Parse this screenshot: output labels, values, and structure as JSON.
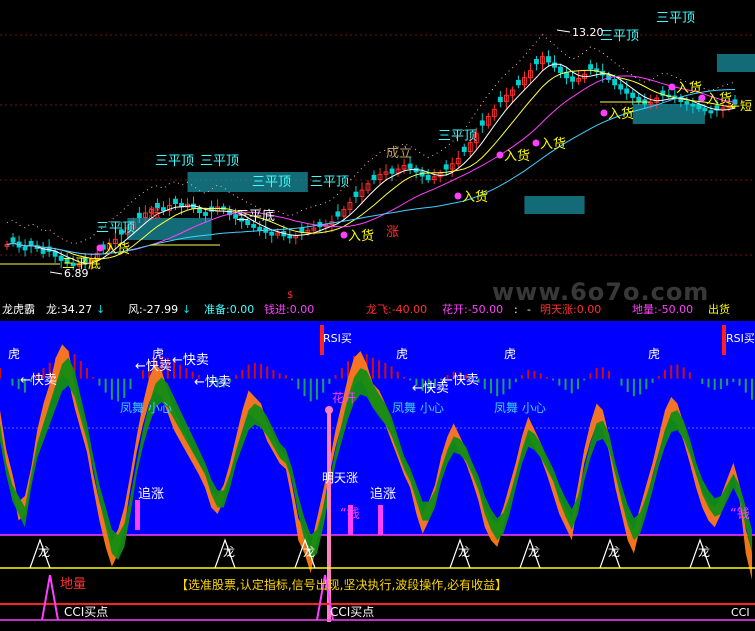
{
  "colors": {
    "background": "#000000",
    "up_candle": "#ff3030",
    "down_candle": "#00d0d0",
    "ma_white": "#ffffff",
    "ma_yellow": "#ffff40",
    "ma_magenta": "#ff40ff",
    "ma_cyan": "#40d0ff",
    "osc_blue": "#0000ff",
    "osc_orange": "#ff7a1a",
    "osc_green": "#128c12",
    "label_cyan": "#40ffff",
    "label_white": "#ffffff",
    "label_magenta": "#ff40ff",
    "label_red": "#ff3030",
    "label_yellow": "#ffff00"
  },
  "watermark": "www.6o7o.com",
  "header": {
    "title": "龙虎霸",
    "items": [
      {
        "text": "龙:34.27",
        "color": "#ffffff"
      },
      {
        "text": "↓",
        "color": "#00e0e0"
      },
      {
        "text": "风:-27.99",
        "color": "#ffffff"
      },
      {
        "text": "↓",
        "color": "#00e0e0"
      },
      {
        "text": "准备:0.00",
        "color": "#40ffff"
      },
      {
        "text": "钱进:0.00",
        "color": "#ff40ff"
      },
      {
        "text": "龙飞:-40.00",
        "color": "#ff3030"
      },
      {
        "text": "花开:-50.00",
        "color": "#ff40ff"
      },
      {
        "text": ":",
        "color": "#ffffff"
      },
      {
        "text": "-",
        "color": "#ffffff"
      },
      {
        "text": "明天涨:0.00",
        "color": "#ff3030"
      },
      {
        "text": "地量:-50.00",
        "color": "#ff40ff"
      },
      {
        "text": "出货",
        "color": "#ffff00"
      }
    ],
    "marker": "$"
  },
  "price_labels": {
    "high_value": "13.20",
    "low_value": "6.89",
    "sanpingding": "三平顶",
    "sanpingdi": "三平底",
    "chengli": "成立",
    "ruhuo": "入货",
    "duan": "短",
    "jinzhang": "涨"
  },
  "osc_labels": {
    "kuaimai": "快卖",
    "hu": "虎",
    "fengwu": "凤舞",
    "xiaoxin": "小心",
    "zhuizhang": "追涨",
    "rsi_buy": "RSI买",
    "huakai": "花开",
    "mingtianzhang": "明天涨",
    "qian": "钱",
    "long": "龙",
    "diliang": "地量",
    "cci_buy": "CCI买点",
    "cci": "CCI"
  },
  "motto": "【选准股票,认定指标,信号出现,坚决执行,波段操作,必有收益】",
  "chart_data": [
    {
      "type": "candlestick",
      "title": "",
      "xlabel": "",
      "ylabel": "",
      "annotations": [
        "13.20",
        "6.89"
      ],
      "ylim": [
        6.2,
        14.0
      ],
      "close": [
        7.55,
        7.62,
        7.48,
        7.4,
        7.52,
        7.44,
        7.3,
        7.36,
        7.22,
        7.1,
        7.02,
        6.95,
        6.98,
        7.05,
        7.12,
        7.3,
        7.42,
        7.58,
        7.7,
        7.85,
        8.02,
        8.18,
        8.32,
        8.45,
        8.55,
        8.6,
        8.52,
        8.66,
        8.72,
        8.62,
        8.7,
        8.58,
        8.46,
        8.38,
        8.5,
        8.62,
        8.55,
        8.4,
        8.3,
        8.22,
        8.12,
        8.04,
        7.96,
        7.9,
        7.82,
        7.88,
        7.8,
        7.74,
        7.8,
        7.9,
        7.96,
        8.02,
        8.06,
        8.12,
        8.2,
        8.36,
        8.55,
        8.75,
        8.92,
        9.1,
        9.28,
        9.4,
        9.55,
        9.62,
        9.58,
        9.7,
        9.8,
        9.72,
        9.62,
        9.5,
        9.4,
        9.48,
        9.58,
        9.7,
        9.85,
        10.0,
        10.2,
        10.45,
        10.7,
        10.95,
        11.2,
        11.4,
        11.62,
        11.8,
        11.95,
        12.1,
        12.3,
        12.5,
        12.7,
        12.9,
        12.75,
        12.6,
        12.45,
        12.3,
        12.2,
        12.28,
        12.4,
        12.55,
        12.48,
        12.38,
        12.25,
        12.1,
        11.98,
        11.86,
        11.74,
        11.62,
        11.55,
        11.6,
        11.72,
        11.8,
        11.78,
        11.7,
        11.62,
        11.55,
        11.5,
        11.42,
        11.36,
        11.3,
        11.38,
        11.44,
        11.5,
        11.55
      ],
      "ma_series": [
        {
          "color": "#ffffff",
          "window": 5
        },
        {
          "color": "#ffff40",
          "window": 10
        },
        {
          "color": "#ff40ff",
          "window": 20
        },
        {
          "color": "#40d0ff",
          "window": 40
        }
      ]
    },
    {
      "type": "area",
      "title": "",
      "ylim": [
        -100,
        120
      ],
      "series": [
        {
          "color": "#ff7a1a",
          "values": [
            40,
            10,
            -10,
            -35,
            -30,
            -5,
            25,
            45,
            60,
            80,
            90,
            85,
            60,
            40,
            20,
            -10,
            -35,
            -55,
            -70,
            -60,
            -40,
            -10,
            20,
            45,
            65,
            75,
            70,
            55,
            40,
            30,
            20,
            10,
            0,
            -10,
            -25,
            -30,
            -20,
            0,
            20,
            40,
            55,
            50,
            45,
            30,
            20,
            10,
            5,
            -20,
            -50,
            -60,
            -75,
            -50,
            -25,
            0,
            25,
            45,
            65,
            80,
            85,
            75,
            60,
            55,
            45,
            30,
            15,
            0,
            -10,
            -30,
            -45,
            -35,
            -20,
            5,
            20,
            30,
            20,
            10,
            -5,
            -20,
            -40,
            -50,
            -55,
            -40,
            -20,
            0,
            20,
            35,
            25,
            15,
            0,
            -15,
            -30,
            -40,
            -50,
            -20,
            10,
            30,
            45,
            40,
            20,
            -10,
            -30,
            -50,
            -60,
            -40,
            -20,
            0,
            20,
            40,
            50,
            45,
            30,
            10,
            -10,
            -25,
            -35,
            -40,
            -30,
            -15,
            0,
            -20,
            -60,
            -80
          ]
        },
        {
          "color": "#128c12",
          "values": [
            30,
            0,
            -20,
            -30,
            -40,
            -10,
            15,
            30,
            45,
            60,
            75,
            80,
            70,
            50,
            30,
            5,
            -20,
            -40,
            -60,
            -65,
            -55,
            -30,
            0,
            25,
            45,
            60,
            65,
            60,
            50,
            40,
            30,
            20,
            10,
            0,
            -15,
            -25,
            -25,
            -10,
            10,
            25,
            40,
            45,
            42,
            35,
            25,
            15,
            10,
            -5,
            -30,
            -50,
            -65,
            -60,
            -40,
            -15,
            10,
            30,
            50,
            65,
            72,
            70,
            60,
            52,
            45,
            35,
            20,
            5,
            -5,
            -20,
            -35,
            -35,
            -25,
            -5,
            10,
            20,
            18,
            12,
            0,
            -12,
            -30,
            -42,
            -50,
            -45,
            -30,
            -10,
            10,
            25,
            22,
            15,
            5,
            -5,
            -20,
            -32,
            -42,
            -30,
            -5,
            15,
            30,
            32,
            22,
            0,
            -20,
            -38,
            -50,
            -45,
            -30,
            -12,
            8,
            25,
            38,
            40,
            32,
            18,
            0,
            -15,
            -25,
            -32,
            -30,
            -20,
            -10,
            -20,
            -40,
            -60
          ]
        }
      ]
    }
  ]
}
